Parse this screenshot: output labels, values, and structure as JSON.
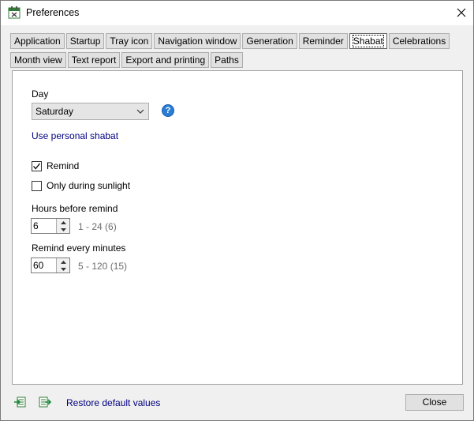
{
  "window": {
    "title": "Preferences"
  },
  "tabs_row1": [
    {
      "label": "Application"
    },
    {
      "label": "Startup"
    },
    {
      "label": "Tray icon"
    },
    {
      "label": "Navigation window"
    },
    {
      "label": "Generation"
    },
    {
      "label": "Reminder"
    },
    {
      "label": "Shabat"
    },
    {
      "label": "Celebrations"
    }
  ],
  "tabs_row2": [
    {
      "label": "Month view"
    },
    {
      "label": "Text report"
    },
    {
      "label": "Export and printing"
    },
    {
      "label": "Paths"
    }
  ],
  "selected_tab": "Shabat",
  "shabat": {
    "day_label": "Day",
    "day_value": "Saturday",
    "personal_link": "Use personal shabat",
    "remind_label": "Remind",
    "remind_checked": true,
    "sunlight_label": "Only during sunlight",
    "sunlight_checked": false,
    "hours_label": "Hours before remind",
    "hours_value": "6",
    "hours_range": "1 - 24 (6)",
    "minutes_label": "Remind every minutes",
    "minutes_value": "60",
    "minutes_range": "5 - 120 (15)"
  },
  "footer": {
    "restore_label": "Restore default values",
    "close_label": "Close"
  },
  "colors": {
    "link": "#000080",
    "help_icon": "#2b7cd3"
  }
}
